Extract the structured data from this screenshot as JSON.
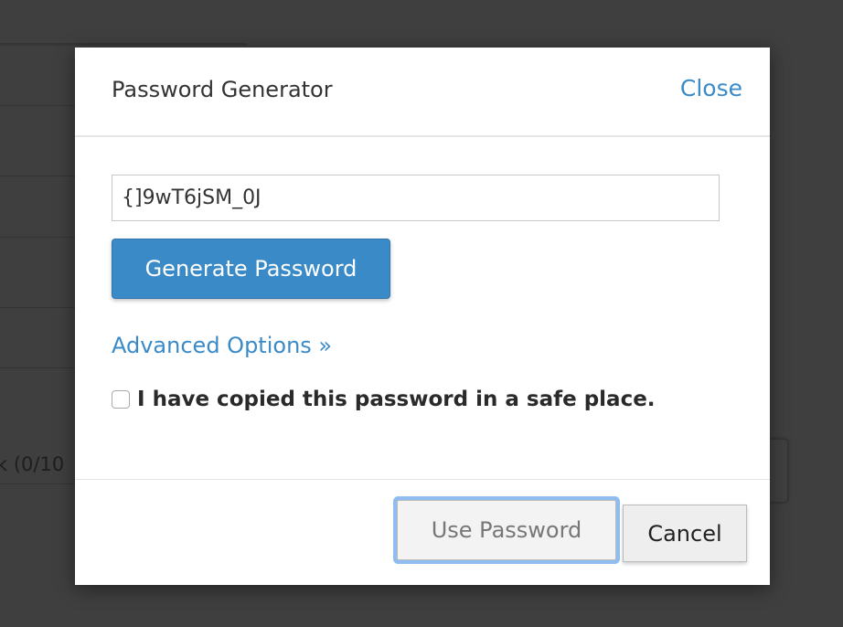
{
  "background": {
    "partial_text": "k (0/10"
  },
  "modal": {
    "title": "Password Generator",
    "close_label": "Close",
    "password_value": "{]9wT6jSM_0J",
    "generate_label": "Generate Password",
    "advanced_label": "Advanced Options »",
    "confirm_label": "I have copied this password in a safe place.",
    "confirm_checked": false,
    "use_label": "Use Password",
    "cancel_label": "Cancel"
  },
  "colors": {
    "accent": "#3a8ac8",
    "overlay": "#3f3f3f",
    "focus_ring": "#8fbdf0"
  }
}
